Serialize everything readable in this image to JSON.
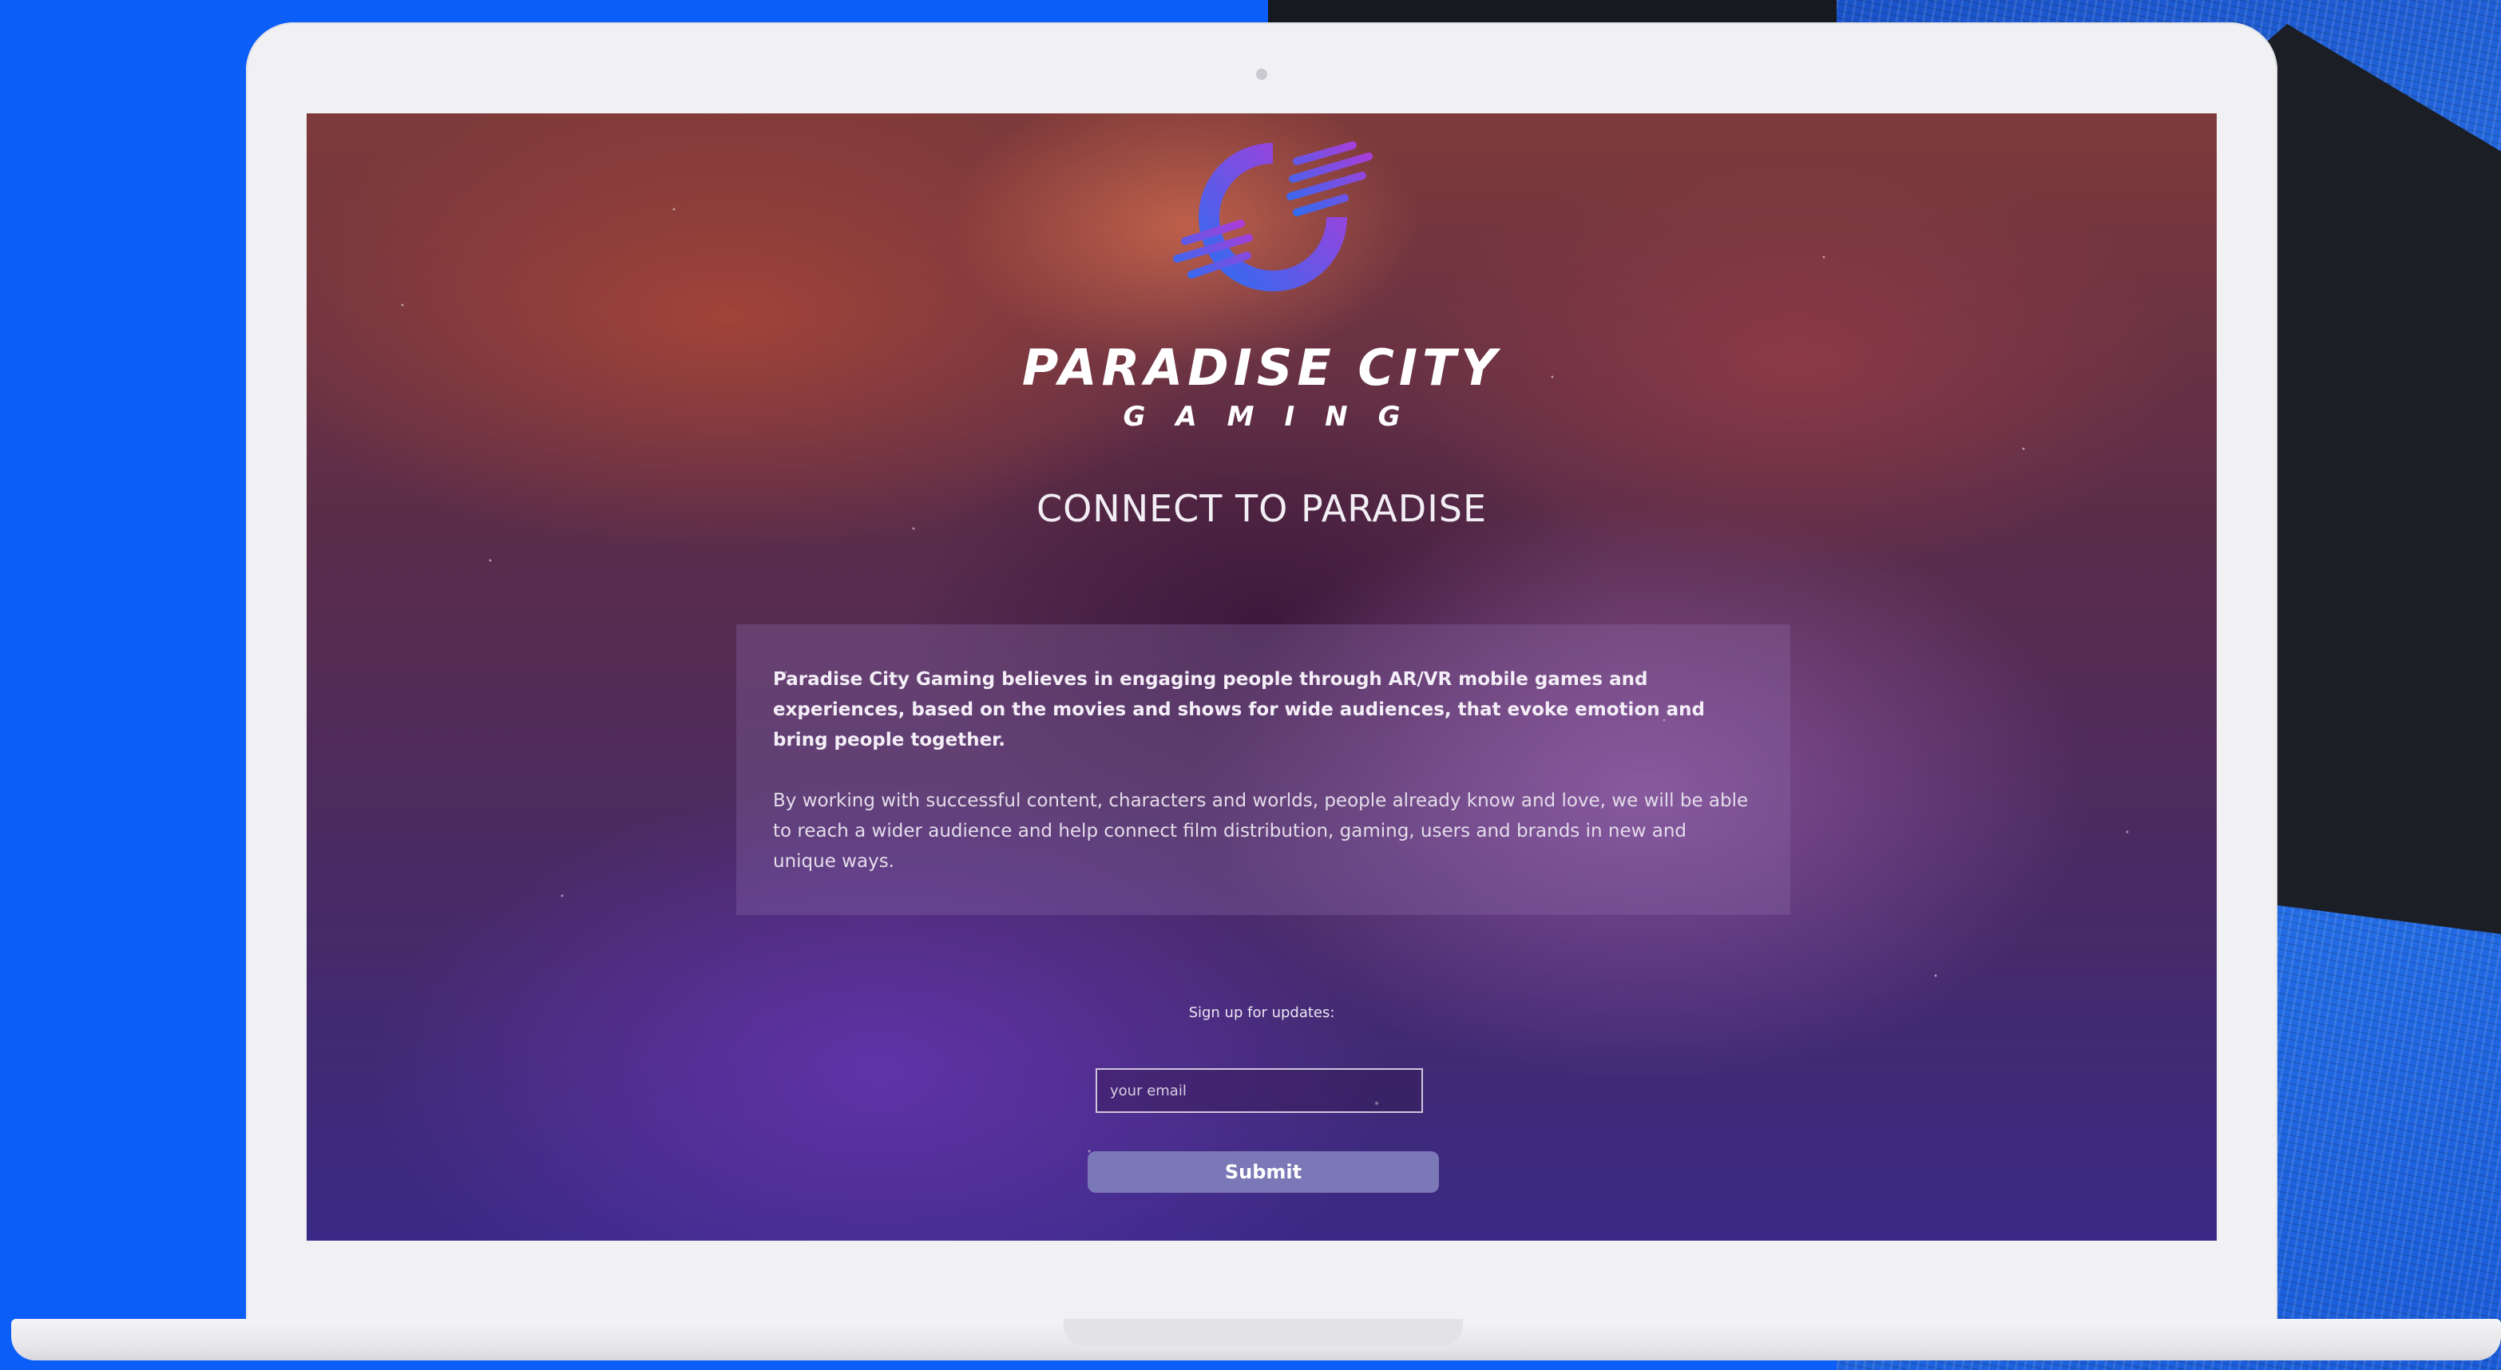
{
  "brand": {
    "title": "PARADISE CITY",
    "subtitle": "GAMING",
    "logo_icon": "paradise-city-logo-icon"
  },
  "headline": "CONNECT TO PARADISE",
  "info_card": {
    "paragraph_bold": "Paradise City Gaming believes in engaging people through AR/VR mobile games and experiences, based on the movies and shows for wide audiences, that evoke emotion and bring people together.",
    "paragraph_normal": "By working with successful content, characters and worlds, people already know and love, we will be able to reach a wider audience and help connect film distribution, gaming, users and brands in new and unique ways."
  },
  "signup": {
    "label": "Sign up for updates:",
    "email_placeholder": "your email",
    "email_value": "",
    "submit_label": "Submit"
  },
  "colors": {
    "page_background": "#0b5ef7",
    "laptop_frame": "#f1f1f3",
    "submit_button": "#7a78b6",
    "logo_gradient_start": "#2f6cf0",
    "logo_gradient_end": "#b13ad8"
  }
}
